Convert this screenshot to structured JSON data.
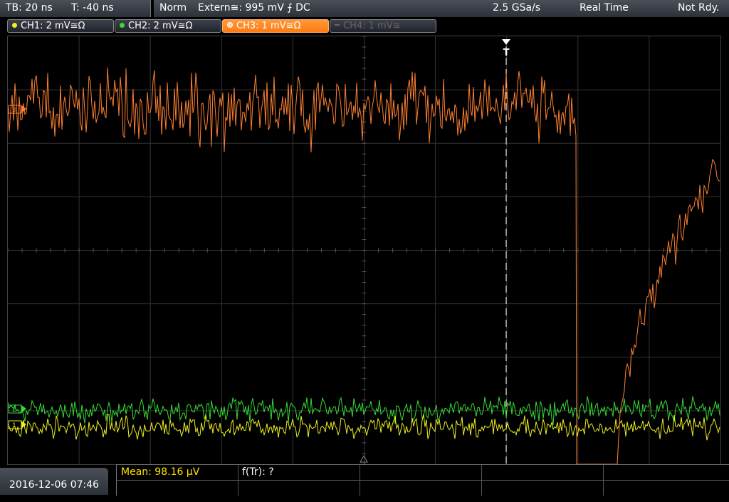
{
  "topbar": {
    "timebase": "TB: 20 ns",
    "trigger_pos": "T: -40 ns",
    "acq_mode": "Norm",
    "trigger_source": "Extern≅: 995 mV ⨍ DC",
    "sample_rate": "2.5 GSa/s",
    "mode": "Real Time",
    "state": "Not Rdy."
  },
  "channels": [
    {
      "label": "CH1: 2 mV≅Ω",
      "color": "#f0f020",
      "active": true
    },
    {
      "label": "CH2: 2 mV≅Ω",
      "color": "#33dd33",
      "active": true
    },
    {
      "label": "CH3: 1 mV≅Ω",
      "color": "#ff8030",
      "active": true,
      "selected": true
    },
    {
      "label": "CH4: 1 mV≅",
      "color": "#777777",
      "active": false
    }
  ],
  "markers": {
    "ch1": "1",
    "ch2": "2",
    "ch3": "3",
    "trigger": "T"
  },
  "timestamp": "2016-12-06 07:46",
  "measurements": {
    "mean": "Mean: 98.16 µV",
    "ftr": "f(Tr): ?"
  },
  "colors": {
    "ch1": "#f0f020",
    "ch2": "#33dd33",
    "ch3": "#ff8030",
    "grid": "#3a3a3a",
    "measure_text": "#ffe000"
  }
}
